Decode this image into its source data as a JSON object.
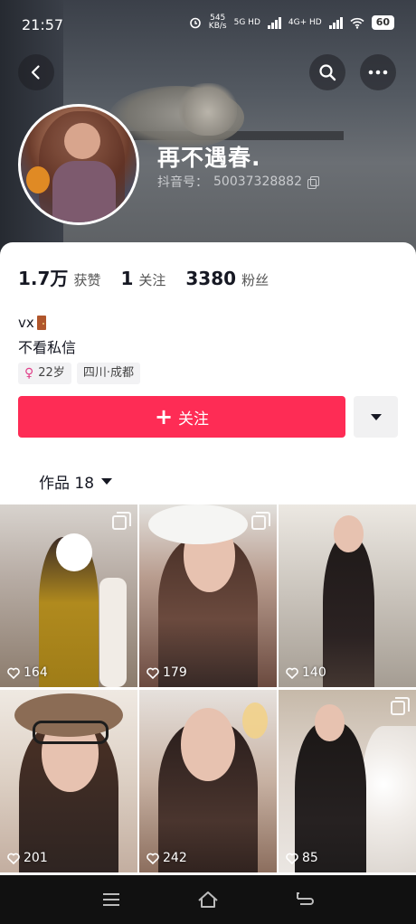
{
  "status_bar": {
    "time": "21:57",
    "net_speed": "545",
    "net_unit": "KB/s",
    "sim1": "5G HD",
    "sim2": "4G+ HD",
    "battery": "60"
  },
  "profile": {
    "nickname": "再不遇春.",
    "douyin_id_label": "抖音号：",
    "douyin_id": "50037328882"
  },
  "stats": [
    {
      "value": "1.7万",
      "label": "获赞"
    },
    {
      "value": "1",
      "label": "关注"
    },
    {
      "value": "3380",
      "label": "粉丝"
    }
  ],
  "bio": {
    "line1": "vx",
    "line2": "不看私信"
  },
  "tags": {
    "age": "22岁",
    "location": "四川·成都"
  },
  "actions": {
    "follow_label": "关注"
  },
  "works_tab": {
    "label": "作品 18"
  },
  "posts": [
    {
      "likes": "164"
    },
    {
      "likes": "179"
    },
    {
      "likes": "140"
    },
    {
      "likes": "201"
    },
    {
      "likes": "242"
    },
    {
      "likes": "85"
    }
  ],
  "colors": {
    "accent": "#fe2c55",
    "female": "#e0418a"
  }
}
